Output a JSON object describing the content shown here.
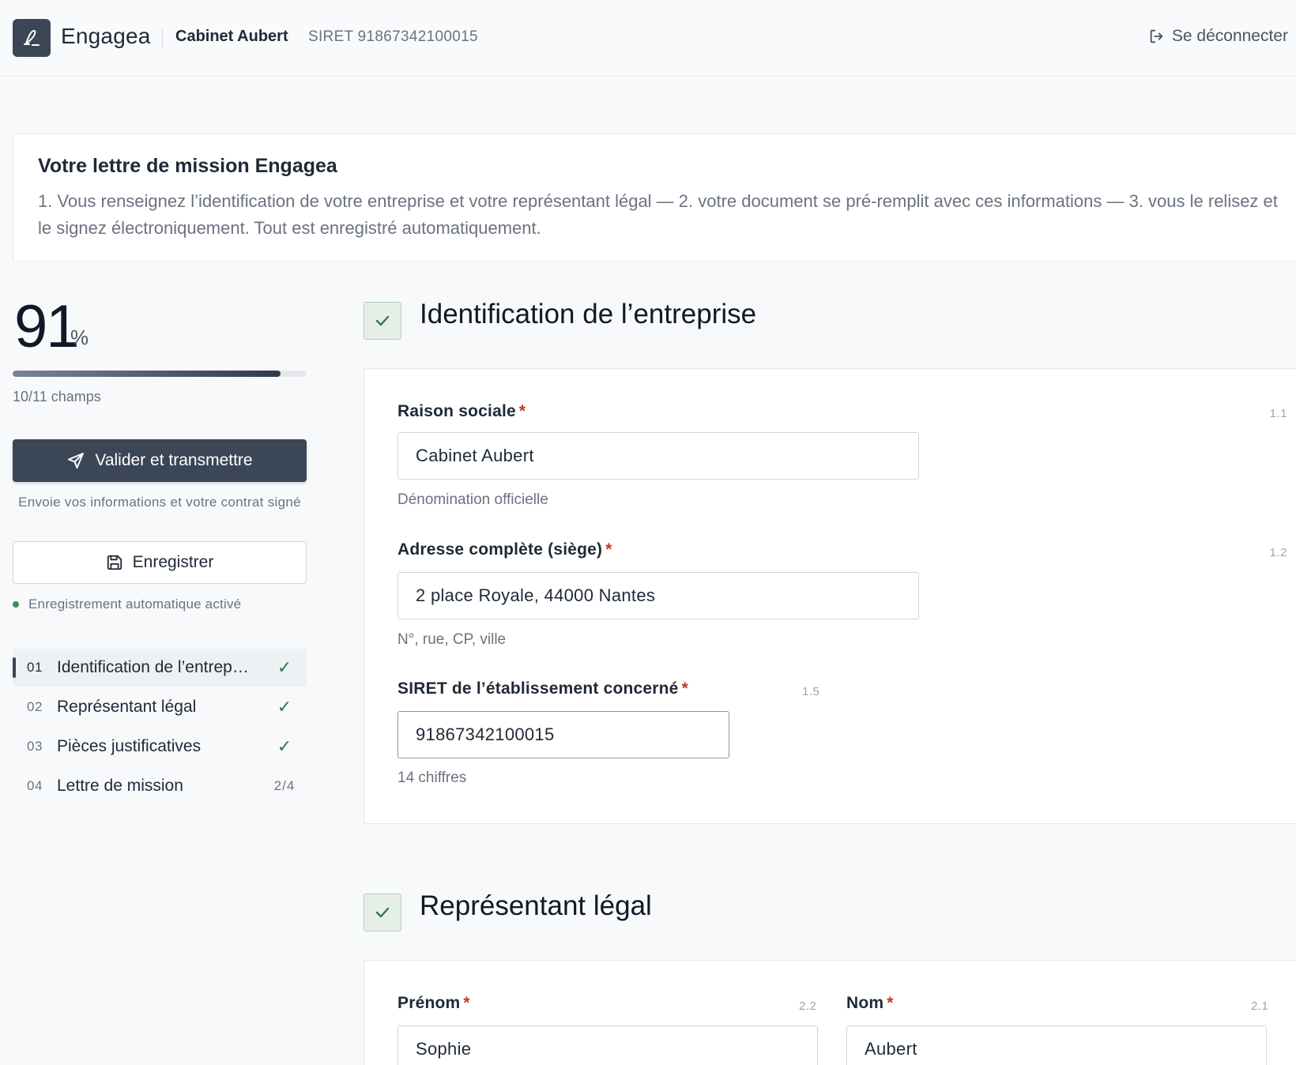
{
  "header": {
    "brand": "Engagea",
    "company": "Cabinet Aubert",
    "siret": "SIRET 91867342100015",
    "logout": "Se déconnecter"
  },
  "intro": {
    "title": "Votre lettre de mission Engagea",
    "text": "1. Vous renseignez l’identification de votre entreprise et votre représentant légal — 2. votre document se pré-remplit avec ces informations — 3. vous le relisez et le signez électroniquement. Tout est enregistré automatiquement."
  },
  "progress": {
    "percent": "91",
    "percent_sign": "%",
    "fill_fraction": 0.91,
    "fields": "10/11 champs"
  },
  "actions": {
    "validate": "Valider et transmettre",
    "validate_sub": "Envoie vos informations et votre contrat signé",
    "save": "Enregistrer",
    "autosave": "Enregistrement automatique activé"
  },
  "nav": [
    {
      "num": "01",
      "label": "Identification de l’entrep…",
      "status": "✓",
      "active": true
    },
    {
      "num": "02",
      "label": "Représentant légal",
      "status": "✓"
    },
    {
      "num": "03",
      "label": "Pièces justificatives",
      "status": "✓"
    },
    {
      "num": "04",
      "label": "Lettre de mission",
      "status": "2/4"
    }
  ],
  "section1": {
    "title": "Identification de l’entreprise",
    "fields": [
      {
        "label": "Raison sociale",
        "ref": "1.1",
        "value": "Cabinet Aubert",
        "help": "Dénomination officielle"
      },
      {
        "label": "Adresse complète (siège)",
        "ref": "1.2",
        "value": "2 place Royale, 44000 Nantes",
        "help": "N°, rue, CP, ville"
      },
      {
        "label": "SIRET de l’établissement concerné",
        "ref": "1.5",
        "value": "91867342100015",
        "help": "14 chiffres"
      }
    ]
  },
  "section2": {
    "title": "Représentant légal",
    "fields": [
      {
        "label": "Prénom",
        "ref": "2.2",
        "value": "Sophie"
      },
      {
        "label": "Nom",
        "ref": "2.1",
        "value": "Aubert"
      }
    ]
  },
  "colors": {
    "primary": "#3b4656",
    "success": "#2f7a4b",
    "required": "#c0392b"
  }
}
